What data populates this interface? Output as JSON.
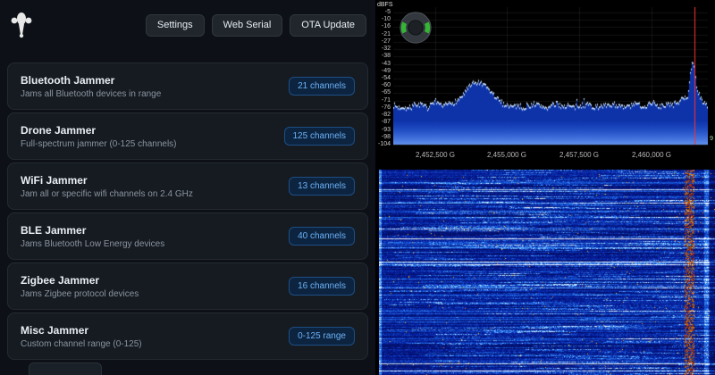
{
  "toolbar": {
    "settings_label": "Settings",
    "web_serial_label": "Web Serial",
    "ota_update_label": "OTA Update"
  },
  "jammers": [
    {
      "title": "Bluetooth Jammer",
      "desc": "Jams all Bluetooth devices in range",
      "badge": "21 channels"
    },
    {
      "title": "Drone Jammer",
      "desc": "Full-spectrum jammer (0-125 channels)",
      "badge": "125 channels"
    },
    {
      "title": "WiFi Jammer",
      "desc": "Jam all or specific wifi channels on 2.4 GHz",
      "badge": "13 channels"
    },
    {
      "title": "BLE Jammer",
      "desc": "Jams Bluetooth Low Energy devices",
      "badge": "40 channels"
    },
    {
      "title": "Zigbee Jammer",
      "desc": "Jams Zigbee protocol devices",
      "badge": "16 channels"
    },
    {
      "title": "Misc Jammer",
      "desc": "Custom channel range (0-125)",
      "badge": "0-125 range"
    }
  ],
  "spectrum": {
    "unit_label": "dBFS",
    "y_ticks": [
      "-5",
      "-10",
      "-16",
      "-21",
      "-27",
      "-32",
      "-38",
      "-43",
      "-49",
      "-54",
      "-60",
      "-65",
      "-71",
      "-76",
      "-82",
      "-87",
      "-93",
      "-98",
      "-104"
    ],
    "x_ticks": [
      "2,452,500 G",
      "2,455,000 G",
      "2,457,500 G",
      "2,460,000 G"
    ],
    "right_tick": "9",
    "marker_color": "#ff3030",
    "marker_frac": 0.957,
    "points": [
      -74,
      -76,
      -75,
      -77,
      -74,
      -73,
      -75,
      -76,
      -72,
      -74,
      -75,
      -73,
      -72,
      -70,
      -66,
      -61,
      -58,
      -57,
      -59,
      -62,
      -66,
      -70,
      -73,
      -74,
      -75,
      -74,
      -76,
      -75,
      -73,
      -74,
      -75,
      -76,
      -74,
      -73,
      -75,
      -74,
      -76,
      -75,
      -74,
      -73,
      -75,
      -76,
      -74,
      -75,
      -73,
      -74,
      -76,
      -75,
      -74,
      -73,
      -75,
      -74,
      -72,
      -74,
      -75,
      -73,
      -74,
      -72,
      -70,
      -68,
      -40,
      -62,
      -72,
      -74
    ]
  },
  "waterfall": {
    "base_color": "#000a30",
    "streak_color": "#2060ff",
    "hot_color": "#ff8200"
  }
}
